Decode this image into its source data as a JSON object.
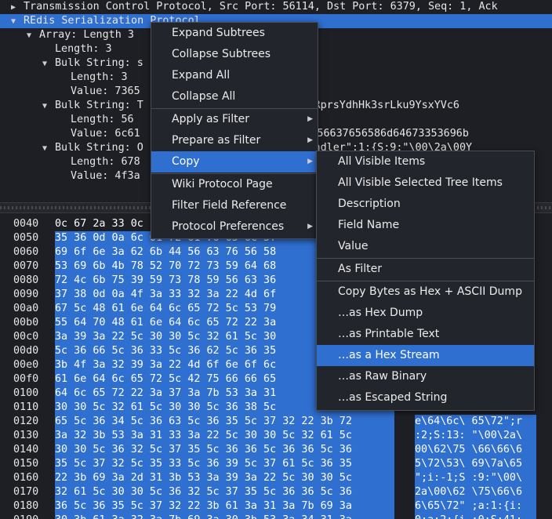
{
  "tree": {
    "rows": [
      {
        "arrow": "▶",
        "indent": 0,
        "text": "Transmission Control Protocol, Src Port: 56114, Dst Port: 6379, Seq: 1, Ack"
      },
      {
        "arrow": "▼",
        "indent": 0,
        "text": "REdis Serialization Protocol",
        "selected": true
      },
      {
        "arrow": "▼",
        "indent": 1,
        "text": "Array: Length 3"
      },
      {
        "arrow": "",
        "indent": 2,
        "text": "Length: 3"
      },
      {
        "arrow": "▼",
        "indent": 2,
        "text": "Bulk String: s"
      },
      {
        "arrow": "",
        "indent": 3,
        "text": "Length: 3"
      },
      {
        "arrow": "",
        "indent": 3,
        "text": "Value: 7365"
      },
      {
        "arrow": "▼",
        "indent": 2,
        "text": "Bulk String: T                  mdg3SikKxRprsYdhHk3srLku9YsxYVc6"
      },
      {
        "arrow": "",
        "indent": 3,
        "text": "Length: 56"
      },
      {
        "arrow": "",
        "indent": 3,
        "text": "Value: 6c61                  6e3a626b4456637656586d64673353696b"
      },
      {
        "arrow": "▼",
        "indent": 2,
        "text": "Bulk String: O                  slogUdpHandler\":1:{S:9:\"\\00\\2a\\00Y"
      },
      {
        "arrow": "",
        "indent": 3,
        "text": "Length: 678"
      },
      {
        "arrow": "",
        "indent": 3,
        "text": "Value: 4f3a                                                   547"
      }
    ]
  },
  "hex": {
    "rows": [
      {
        "off": "0040",
        "bytes": "0c 67 2a 33 0c",
        "ascii": ""
      },
      {
        "off": "0050",
        "bytes": "35 36 0d 0a 6c 61 72 61 76 65 6c 5f",
        "ascii": ""
      },
      {
        "off": "0060",
        "bytes": "69 6f 6e 3a 62 6b 44 56 63 76 56 58",
        "ascii": ""
      },
      {
        "off": "0070",
        "bytes": "53 69 6b 4b 78 52 70 72 73 59 64 68",
        "ascii": ""
      },
      {
        "off": "0080",
        "bytes": "72 4c 6b 75 39 59 73 78 59 56 63 36",
        "ascii": ""
      },
      {
        "off": "0090",
        "bytes": "37 38 0d 0a 4f 3a 33 32 3a 22 4d 6f",
        "ascii": ""
      },
      {
        "off": "00a0",
        "bytes": "67 5c 48 61 6e 64 6c 65 72 5c 53 79",
        "ascii": ""
      },
      {
        "off": "00b0",
        "bytes": "55 64 70 48 61 6e 64 6c 65 72 22 3a",
        "ascii": ""
      },
      {
        "off": "00c0",
        "bytes": "3a 39 3a 22 5c 30 30 5c 32 61 5c 30",
        "ascii": ""
      },
      {
        "off": "00d0",
        "bytes": "5c 36 66 5c 36 33 5c 36 62 5c 36 35",
        "ascii": ""
      },
      {
        "off": "00e0",
        "bytes": "3b 4f 3a 32 39 3a 22 4d 6f 6e 6f 6c",
        "ascii": ""
      },
      {
        "off": "00f0",
        "bytes": "61 6e 64 6c 65 72 5c 42 75 66 66 65",
        "ascii": ""
      },
      {
        "off": "0100",
        "bytes": "64 6c 65 72 22 3a 37 3a 7b 53 3a 31",
        "ascii": ""
      },
      {
        "off": "0110",
        "bytes": "30 30 5c 32 61 5c 30 30 5c 36 38 5c",
        "ascii": ""
      },
      {
        "off": "0120",
        "bytes": "65 5c 36 34 5c 36 63 5c 36 35 5c 37 32 22 3b 72",
        "ascii": "e\\64\\6c\\ 65\\72\";r"
      },
      {
        "off": "0130",
        "bytes": "3a 32 3b 53 3a 31 33 3a 22 5c 30 30 5c 32 61 5c",
        "ascii": ":2;S:13: \"\\00\\2a\\"
      },
      {
        "off": "0140",
        "bytes": "30 30 5c 36 32 5c 37 35 5c 36 36 5c 36 36 5c 36",
        "ascii": "00\\62\\75 \\66\\66\\6"
      },
      {
        "off": "0150",
        "bytes": "35 5c 37 32 5c 35 33 5c 36 39 5c 37 61 5c 36 35",
        "ascii": "5\\72\\53\\ 69\\7a\\65"
      },
      {
        "off": "0160",
        "bytes": "22 3b 69 3a 2d 31 3b 53 3a 39 3a 22 5c 30 30 5c",
        "ascii": "\";i:-1;S :9:\"\\00\\"
      },
      {
        "off": "0170",
        "bytes": "32 61 5c 30 30 5c 36 32 5c 37 35 5c 36 36 5c 36",
        "ascii": "2a\\00\\62 \\75\\66\\6"
      },
      {
        "off": "0180",
        "bytes": "36 5c 36 35 5c 37 32 22 3b 61 3a 31 3a 7b 69 3a",
        "ascii": "6\\65\\72\" ;a:1:{i:"
      },
      {
        "off": "0190",
        "bytes": "30 3b 61 3a 32 3a 7b 69 3a 30 3b 53 3a 34 31 3a",
        "ascii": "0;a:2:{i :0;S:41:"
      }
    ]
  },
  "context_menu": {
    "items": [
      {
        "label": "Expand Subtrees",
        "submenu": false
      },
      {
        "label": "Collapse Subtrees",
        "submenu": false
      },
      {
        "label": "Expand All",
        "submenu": false
      },
      {
        "label": "Collapse All",
        "submenu": false
      },
      {
        "sep": true
      },
      {
        "label": "Apply as Filter",
        "submenu": true
      },
      {
        "label": "Prepare as Filter",
        "submenu": true
      },
      {
        "label": "Copy",
        "submenu": true,
        "highlighted": true
      },
      {
        "sep": true
      },
      {
        "label": "Wiki Protocol Page",
        "submenu": false
      },
      {
        "label": "Filter Field Reference",
        "submenu": false
      },
      {
        "label": "Protocol Preferences",
        "submenu": true
      }
    ]
  },
  "copy_submenu": {
    "items": [
      {
        "label": "All Visible Items"
      },
      {
        "label": "All Visible Selected Tree Items"
      },
      {
        "label": "Description"
      },
      {
        "label": "Field Name"
      },
      {
        "label": "Value"
      },
      {
        "sep": true
      },
      {
        "label": "As Filter"
      },
      {
        "sep": true
      },
      {
        "label": "Copy Bytes as Hex + ASCII Dump"
      },
      {
        "label": "…as Hex Dump"
      },
      {
        "label": "…as Printable Text"
      },
      {
        "label": "…as a Hex Stream",
        "highlighted": true
      },
      {
        "label": "…as Raw Binary"
      },
      {
        "label": "…as Escaped String"
      }
    ]
  },
  "colors": {
    "selection": "#2f6fd0",
    "background": "#1e1f24",
    "menu_bg": "#23252c"
  }
}
